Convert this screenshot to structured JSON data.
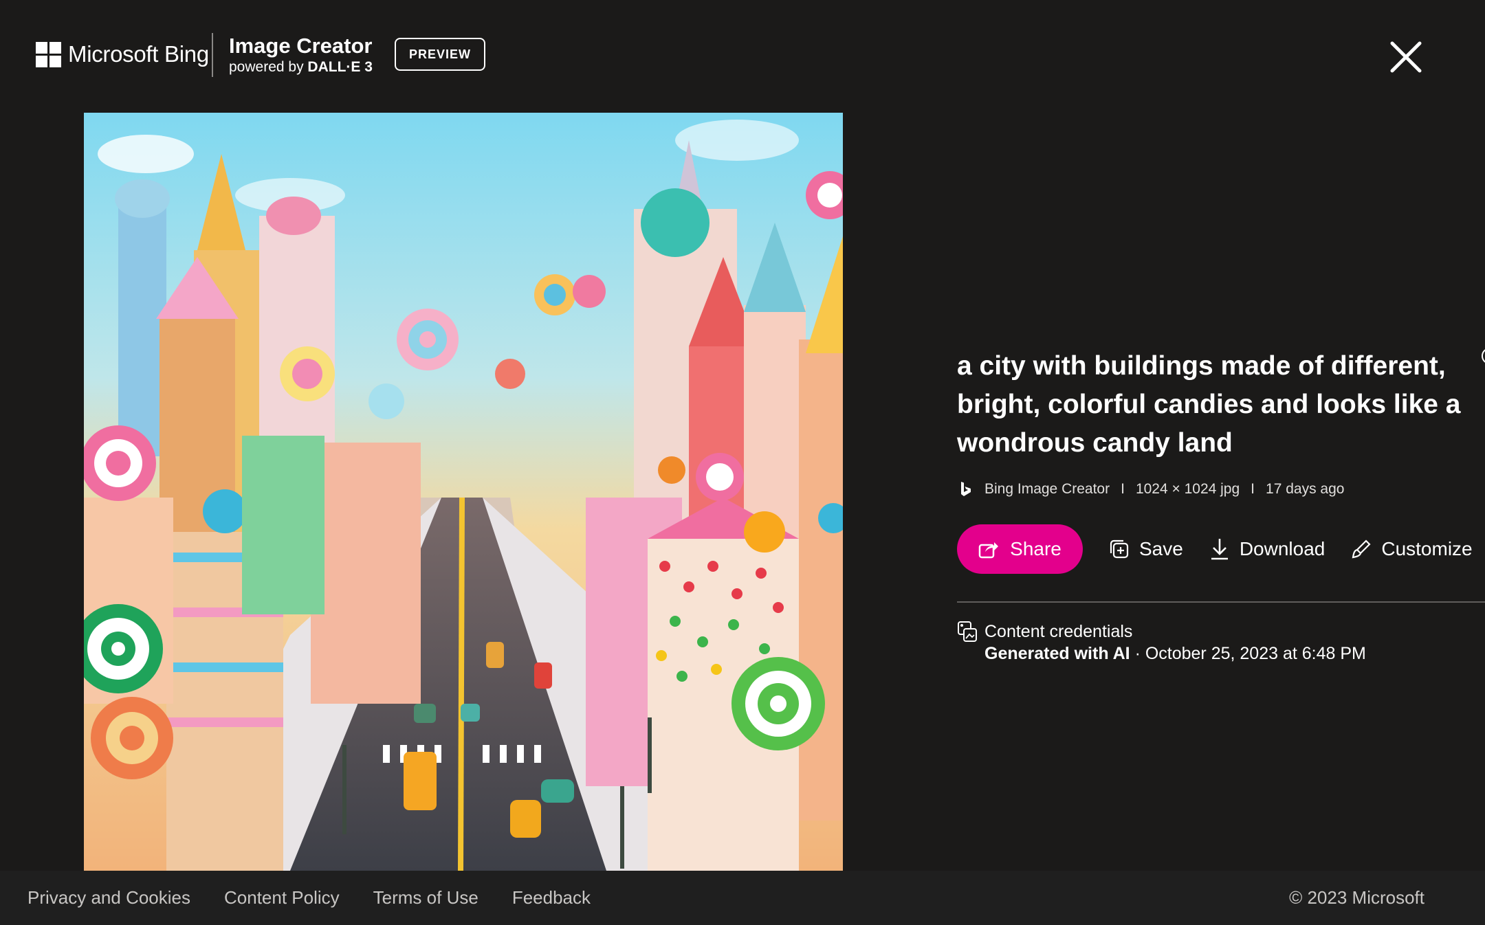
{
  "header": {
    "brand_name": "Microsoft Bing",
    "product_title": "Image Creator",
    "product_powered": "powered by",
    "product_model": "DALL·E 3",
    "preview_badge": "PREVIEW",
    "close_icon": "close-icon"
  },
  "image": {
    "alt": "a city with buildings made of different, bright, colorful candies and looks like a wondrous candy land"
  },
  "details": {
    "prompt": "a city with buildings made of different, bright, colorful candies and looks like a wondrous candy land",
    "meta": {
      "source": "Bing Image Creator",
      "separator": "I",
      "size": "1024 × 1024 jpg",
      "age": "17 days ago"
    },
    "actions": {
      "share": "Share",
      "save": "Save",
      "download": "Download",
      "customize": "Customize"
    },
    "credentials": {
      "label": "Content credentials",
      "generated": "Generated with AI",
      "date": "· October 25, 2023 at 6:48 PM"
    }
  },
  "footer": {
    "links": [
      "Privacy and Cookies",
      "Content Policy",
      "Terms of Use",
      "Feedback"
    ],
    "copyright": "© 2023 Microsoft"
  },
  "colors": {
    "background": "#1b1a19",
    "share_accent": "#e3008c",
    "footer_bg": "#1f1f1f"
  }
}
